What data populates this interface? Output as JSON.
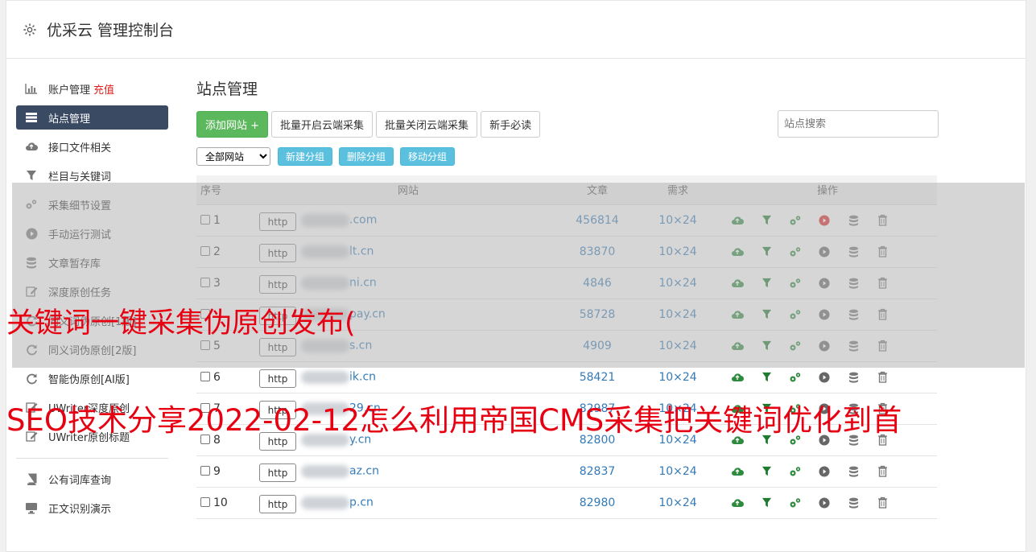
{
  "header": {
    "title": "优采云 管理控制台",
    "icon": "gear-icon"
  },
  "sidebar": {
    "items": [
      {
        "label": "账户管理",
        "extra": "充值",
        "icon": "bar-chart-icon"
      },
      {
        "label": "站点管理",
        "icon": "server-list-icon",
        "active": true
      },
      {
        "label": "接口文件相关",
        "icon": "cloud-upload-icon"
      },
      {
        "label": "栏目与关键词",
        "icon": "filter-icon"
      },
      {
        "label": "采集细节设置",
        "icon": "gears-icon"
      },
      {
        "label": "手动运行测试",
        "icon": "play-circle-icon"
      },
      {
        "label": "文章暂存库",
        "icon": "database-icon"
      },
      {
        "label": "深度原创任务",
        "icon": "edit-icon"
      },
      {
        "label": "同义词伪原创[1版]",
        "icon": "refresh-icon"
      },
      {
        "label": "同义词伪原创[2版]",
        "icon": "refresh-icon"
      },
      {
        "label": "智能伪原创[AI版]",
        "icon": "refresh-icon"
      },
      {
        "label": "UWriter深度原创",
        "icon": "edit-icon"
      },
      {
        "label": "UWriter原创标题",
        "icon": "edit-icon"
      }
    ],
    "bottom_items": [
      {
        "label": "公有词库查询",
        "icon": "book-icon"
      },
      {
        "label": "正文识别演示",
        "icon": "monitor-icon"
      }
    ]
  },
  "main": {
    "title": "站点管理",
    "buttons": {
      "add": "添加网站 +",
      "batch_open": "批量开启云端采集",
      "batch_close": "批量关闭云端采集",
      "guide": "新手必读"
    },
    "search_placeholder": "站点搜索",
    "group_select": "全部网站",
    "group_buttons": {
      "new": "新建分组",
      "delete": "删除分组",
      "move": "移动分组"
    },
    "table": {
      "headers": {
        "no": "序号",
        "site": "网站",
        "articles": "文章",
        "demand": "需求",
        "ops": "操作"
      },
      "rows": [
        {
          "no": "1",
          "protocol": "http",
          "domain": ".com",
          "articles": "456814",
          "demand": "10×24",
          "running": true
        },
        {
          "no": "2",
          "protocol": "http",
          "domain": "lt.cn",
          "articles": "83870",
          "demand": "10×24"
        },
        {
          "no": "3",
          "protocol": "http",
          "domain": "ni.cn",
          "articles": "4846",
          "demand": "10×24"
        },
        {
          "no": "",
          "protocol": "http",
          "domain": "pay.cn",
          "articles": "58728",
          "demand": "10×24"
        },
        {
          "no": "5",
          "protocol": "http",
          "domain": "s.cn",
          "articles": "4909",
          "demand": "10×24"
        },
        {
          "no": "6",
          "protocol": "http",
          "domain": "ik.cn",
          "articles": "58421",
          "demand": "10×24"
        },
        {
          "no": "7",
          "protocol": "http",
          "domain": "29.cn",
          "articles": "82987",
          "demand": "10×24"
        },
        {
          "no": "8",
          "protocol": "http",
          "domain": "y.cn",
          "articles": "82800",
          "demand": "10×24"
        },
        {
          "no": "9",
          "protocol": "http",
          "domain": "az.cn",
          "articles": "82837",
          "demand": "10×24"
        },
        {
          "no": "10",
          "protocol": "http",
          "domain": "p.cn",
          "articles": "82980",
          "demand": "10×24"
        }
      ]
    }
  },
  "overlay_captions": {
    "line1": "关键词一键采集伪原创发布(",
    "line2": "SEO技术分享2022-02-12怎么利用帝国CMS采集把关键词优化到首"
  },
  "colors": {
    "accent_red": "#e60012",
    "active_bg": "#3a4a63",
    "link_blue": "#337ab7",
    "green": "#5cb85c",
    "info": "#5bc0de"
  }
}
